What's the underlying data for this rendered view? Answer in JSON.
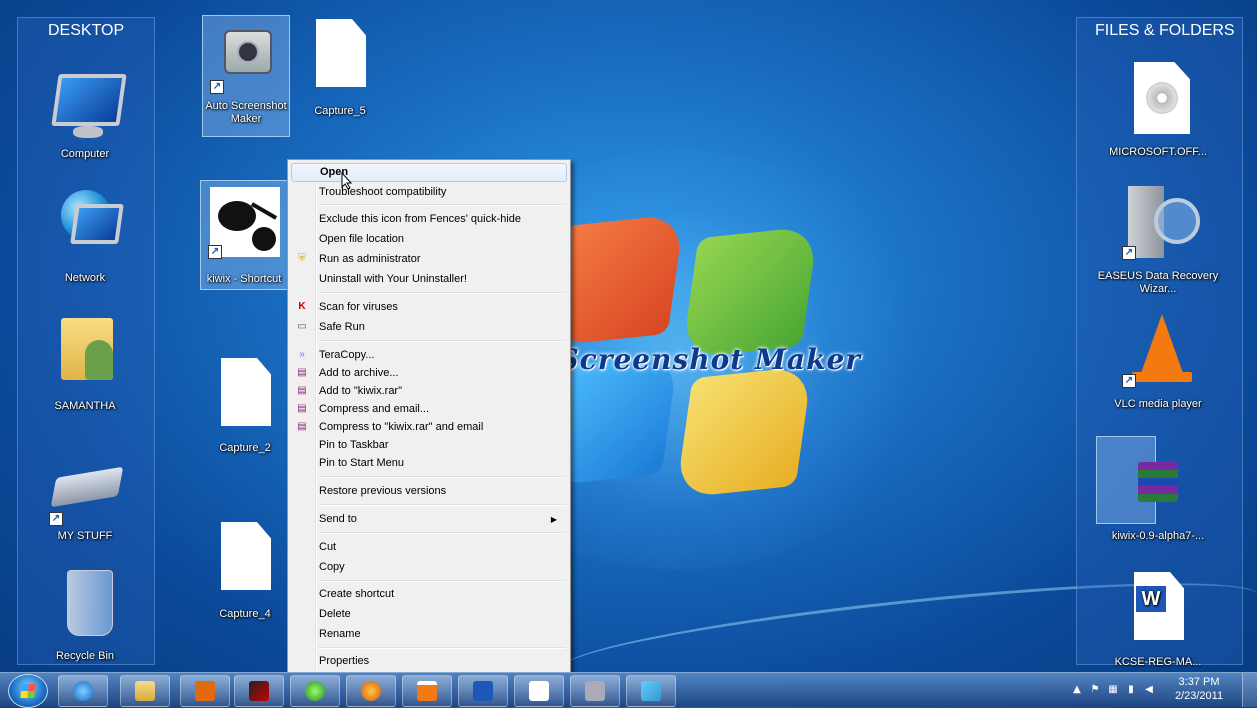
{
  "fences": {
    "left_title": "DESKTOP",
    "right_title": "FILES & FOLDERS"
  },
  "desktop_icons": {
    "computer": "Computer",
    "network": "Network",
    "samantha": "SAMANTHA",
    "my_stuff": "MY STUFF",
    "recycle_bin": "Recycle Bin",
    "auto_screenshot": "Auto Screenshot Maker",
    "capture5": "Capture_5",
    "kiwix_shortcut": "kiwix - Shortcut",
    "capture2": "Capture_2",
    "capture4": "Capture_4",
    "microsoft_off": "MICROSOFT.OFF...",
    "easeus": "EASEUS Data Recovery Wizar...",
    "vlc": "VLC media player",
    "kiwix_alpha": "kiwix-0.9-alpha7-...",
    "kcse": "KCSE-REG-MA..."
  },
  "watermark": "Auto Screenshot Maker",
  "context_menu": {
    "open": "Open",
    "troubleshoot": "Troubleshoot compatibility",
    "exclude_fences": "Exclude this icon from Fences' quick-hide",
    "open_location": "Open file location",
    "run_admin": "Run as administrator",
    "uninstall": "Uninstall with Your Uninstaller!",
    "scan_viruses": "Scan for viruses",
    "safe_run": "Safe Run",
    "teracopy": "TeraCopy...",
    "add_archive": "Add to archive...",
    "add_kiwix_rar": "Add to \"kiwix.rar\"",
    "compress_email": "Compress and email...",
    "compress_kiwix_email": "Compress to \"kiwix.rar\" and email",
    "pin_taskbar": "Pin to Taskbar",
    "pin_start": "Pin to Start Menu",
    "restore_versions": "Restore previous versions",
    "send_to": "Send to",
    "cut": "Cut",
    "copy": "Copy",
    "create_shortcut": "Create shortcut",
    "delete": "Delete",
    "rename": "Rename",
    "properties": "Properties"
  },
  "taskbar": {
    "time": "3:37 PM",
    "date": "2/23/2011",
    "apps": [
      "internet-explorer",
      "file-explorer",
      "media-player",
      "kaspersky",
      "utorrent",
      "firefox",
      "vlc",
      "word",
      "kiwix",
      "auto-screenshot-maker",
      "control-panel"
    ]
  }
}
